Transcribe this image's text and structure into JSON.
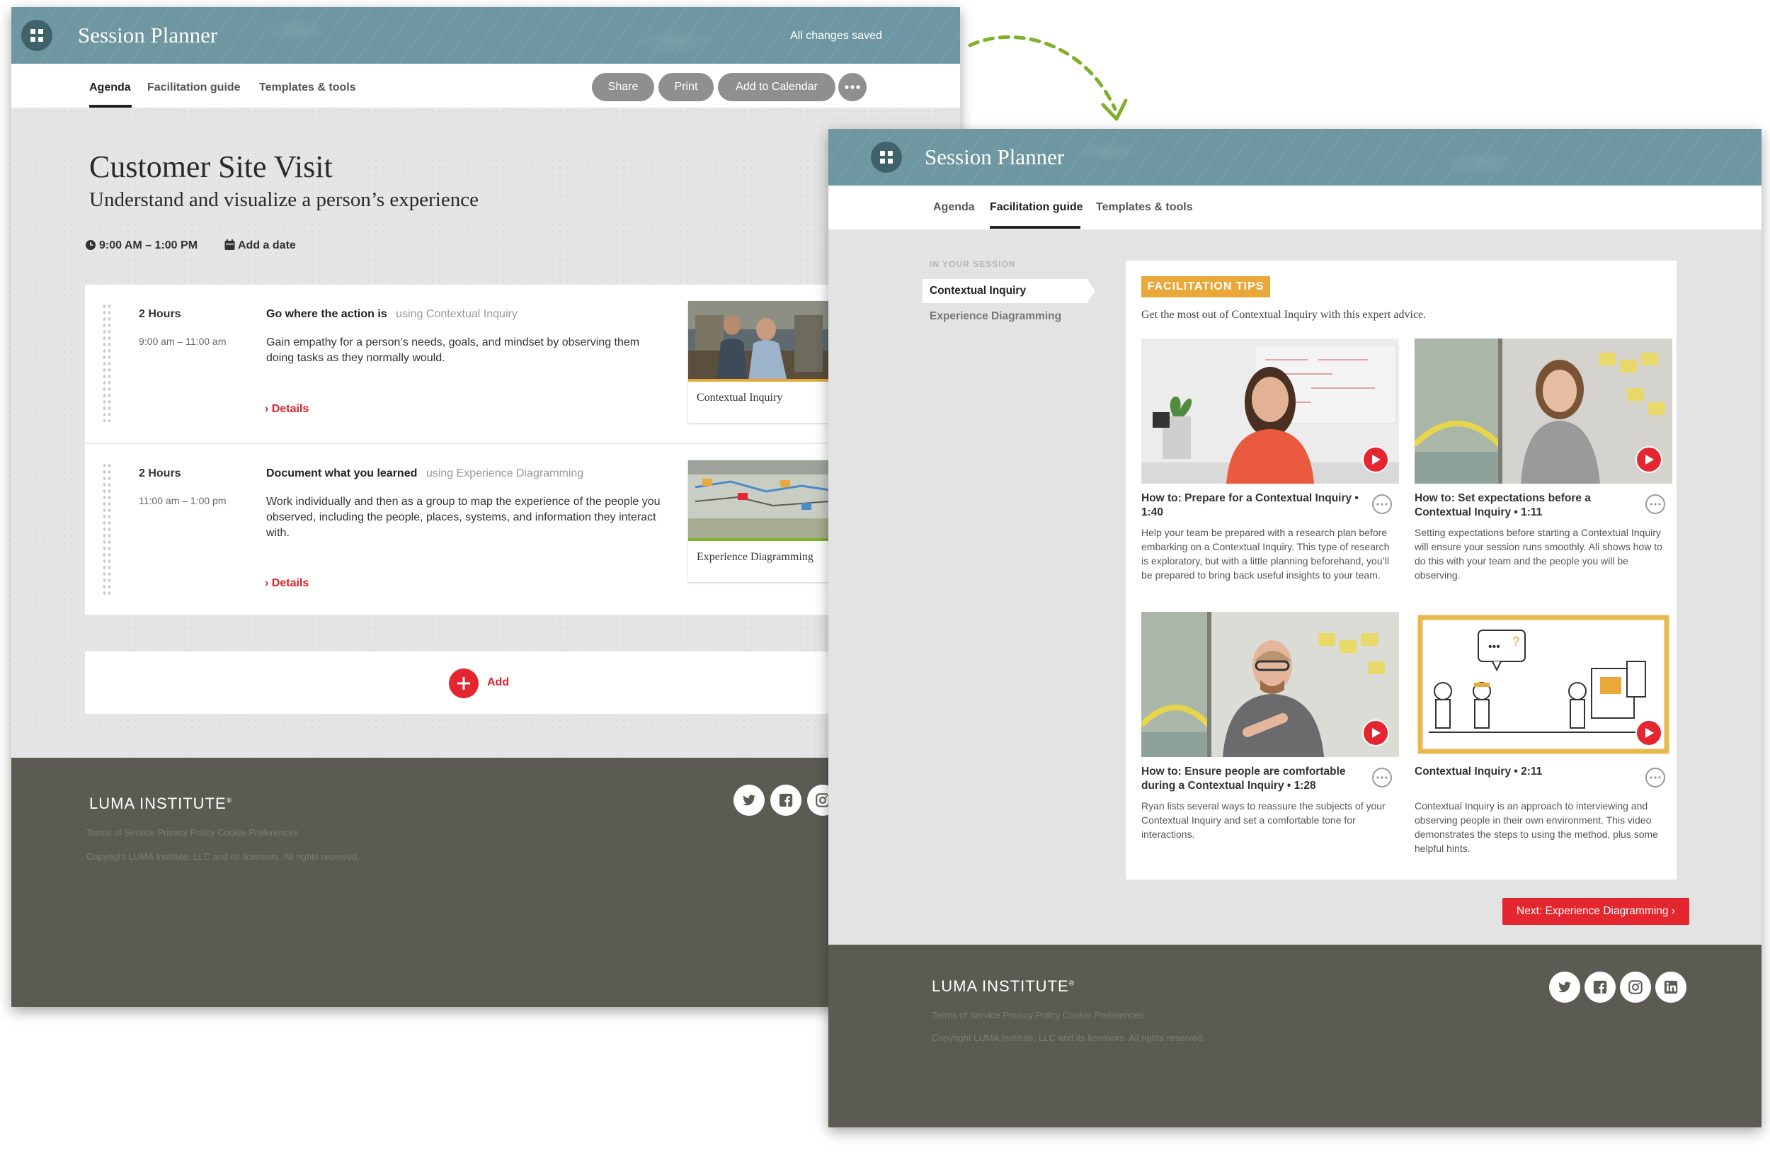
{
  "app": {
    "title": "Session Planner",
    "save_status": "All changes saved"
  },
  "tabs": {
    "agenda": "Agenda",
    "facilitation": "Facilitation guide",
    "templates": "Templates & tools"
  },
  "toolbar": {
    "share": "Share",
    "print": "Print",
    "add_calendar": "Add to Calendar"
  },
  "session": {
    "title": "Customer Site Visit",
    "subtitle": "Understand and visualize a person’s experience",
    "time": "9:00 AM – 1:00 PM",
    "add_date": "Add a date"
  },
  "agenda_items": [
    {
      "duration": "2 Hours",
      "time_range": "9:00 am – 11:00 am",
      "heading": "Go where the action is",
      "using_label": "using",
      "method": "Contextual Inquiry",
      "description": "Gain empathy for a person’s needs, goals, and mindset by observing them doing tasks as they normally would.",
      "details": "Details",
      "thumb_caption": "Contextual Inquiry"
    },
    {
      "duration": "2 Hours",
      "time_range": "11:00 am – 1:00 pm",
      "heading": "Document what you learned",
      "using_label": "using",
      "method": "Experience Diagramming",
      "description": "Work individually and then as a group to map the experience of the people you observed, including the people, places, systems, and information they interact with.",
      "details": "Details",
      "thumb_caption": "Experience Diagramming"
    }
  ],
  "add_label": "Add",
  "footer": {
    "brand": "LUMA INSTITUTE",
    "brand_mark": "®",
    "links": [
      "Terms of Service",
      "Privacy Policy",
      "Cookie Preferences"
    ],
    "copyright": "Copyright LUMA Institute, LLC and its licensors. All rights reserved.",
    "social_icons": [
      "twitter-icon",
      "facebook-icon",
      "instagram-icon",
      "linkedin-icon"
    ]
  },
  "guide": {
    "sidebar_heading": "IN YOUR SESSION",
    "sidebar_items": [
      "Contextual Inquiry",
      "Experience Diagramming"
    ],
    "badge": "FACILITATION TIPS",
    "intro": "Get the most out of Contextual Inquiry with this expert advice.",
    "videos": [
      {
        "title": "How to: Prepare for a Contextual Inquiry",
        "duration": "1:40",
        "description": "Help your team be prepared with a research plan before embarking on a Contextual Inquiry. This type of research is exploratory, but with a little planning beforehand, you’ll be prepared to bring back useful insights to your team."
      },
      {
        "title": "How to: Set expectations before a Contextual Inquiry",
        "duration": "1:11",
        "description": "Setting expectations before starting a Contextual Inquiry will ensure your session runs smoothly. Ali shows how to do this with your team and the people you will be observing."
      },
      {
        "title": "How to: Ensure people are comfortable during a Contextual Inquiry",
        "duration": "1:28",
        "description": "Ryan lists several ways to reassure the subjects of your Contextual Inquiry and set a comfortable tone for interactions."
      },
      {
        "title": "Contextual Inquiry",
        "duration": "2:11",
        "description": "Contextual Inquiry is an approach to interviewing and observing people in their own environment. This video demonstrates the steps to using the method, plus some helpful hints."
      }
    ],
    "next_button": "Next: Experience Diagramming"
  },
  "colors": {
    "header": "#6f97a2",
    "accent_red": "#e3262f",
    "badge_gold": "#e9a83a",
    "footer": "#5b5b53",
    "arrow_green": "#7fb02a"
  }
}
